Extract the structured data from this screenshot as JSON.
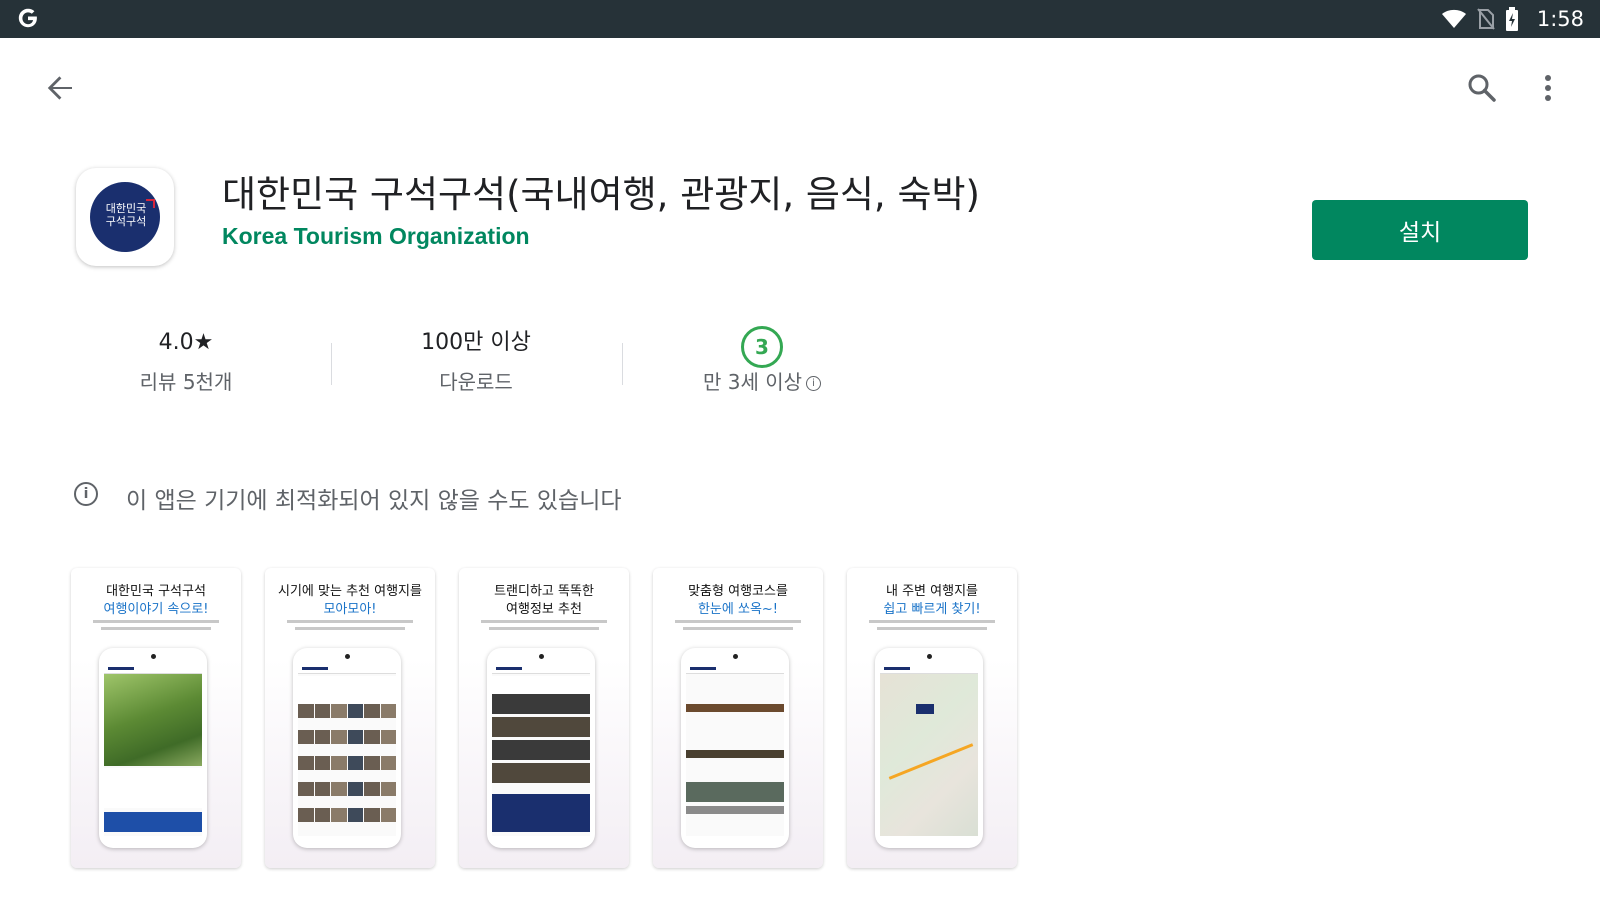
{
  "status_bar": {
    "time": "1:58",
    "icons": [
      "google-g-icon",
      "wifi-icon",
      "no-sim-icon",
      "battery-charging-icon"
    ]
  },
  "toolbar": {
    "back_icon": "arrow-back-icon",
    "search_icon": "search-icon",
    "more_icon": "more-vert-icon"
  },
  "app": {
    "title": "대한민국 구석구석(국내여행, 관광지, 음식, 숙박)",
    "developer": "Korea Tourism Organization",
    "icon_text_line1": "대한민국",
    "icon_text_line2": "구석구석",
    "install_label": "설치",
    "colors": {
      "accent": "#01875f",
      "icon_bg": "#1a2f6e"
    }
  },
  "stats": {
    "rating": "4.0★",
    "reviews": "리뷰 5천개",
    "downloads": "100만 이상",
    "downloads_label": "다운로드",
    "age_rating": "3",
    "age_label": "만 3세 이상"
  },
  "warning": {
    "text": "이 앱은 기기에 최적화되어 있지 않을 수도 있습니다"
  },
  "screenshots": [
    {
      "line1": "대한민국 구석구석",
      "line2": "여행이야기 속으로!"
    },
    {
      "line1": "시기에 맞는 추천 여행지를",
      "line2": "모아모아!"
    },
    {
      "line1": "트랜디하고 똑똑한",
      "line2": "여행정보 추천"
    },
    {
      "line1": "맞춤형 여행코스를",
      "line2": "한눈에 쏘옥~!"
    },
    {
      "line1": "내 주변 여행지를",
      "line2": "쉽고 빠르게 찾기!"
    }
  ]
}
